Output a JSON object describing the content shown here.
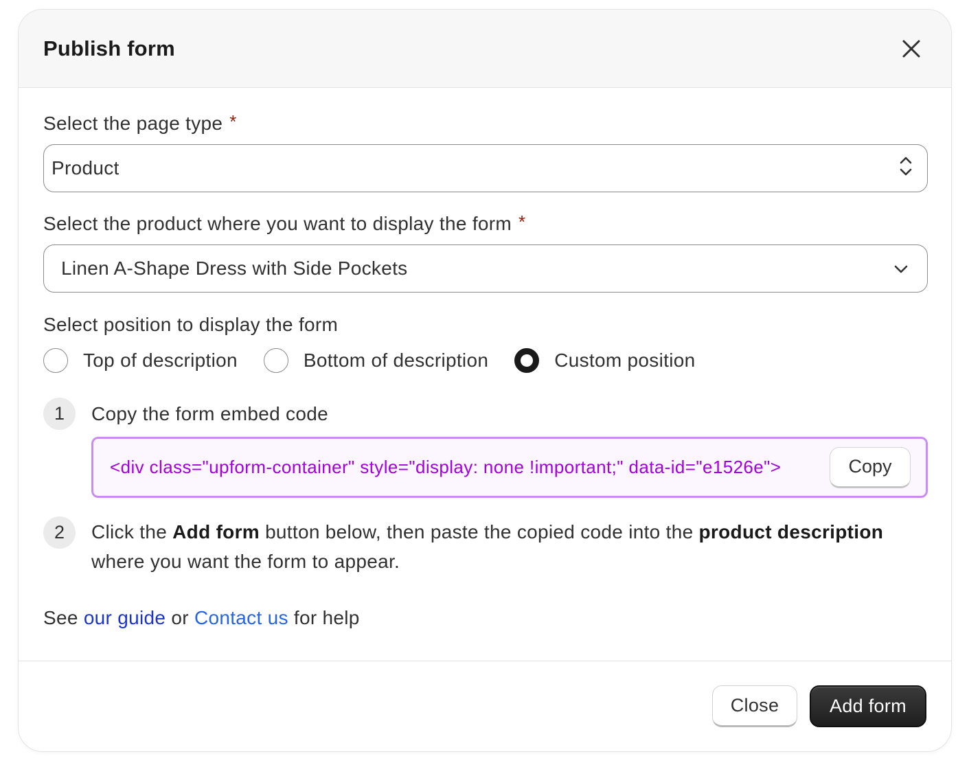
{
  "modal": {
    "title": "Publish form"
  },
  "page_type": {
    "label": "Select the page type",
    "required_mark": "*",
    "value": "Product"
  },
  "product": {
    "label": "Select the product where you want to display the form",
    "required_mark": "*",
    "value": "Linen A-Shape Dress with Side Pockets"
  },
  "position": {
    "label": "Select position to display the form",
    "options": [
      {
        "label": "Top of description",
        "checked": false
      },
      {
        "label": "Bottom of description",
        "checked": false
      },
      {
        "label": "Custom position",
        "checked": true
      }
    ]
  },
  "steps": {
    "step1": {
      "number": "1",
      "title": "Copy the form embed code",
      "code": "<div class=\"upform-container\" style=\"display: none !important;\" data-id=\"e1526e\">",
      "copy_label": "Copy"
    },
    "step2": {
      "number": "2",
      "text_1": "Click the ",
      "bold_1": "Add form",
      "text_2": " button below, then paste the copied code into the ",
      "bold_2": "product description",
      "text_3": " where you want the form to appear."
    }
  },
  "help": {
    "prefix": "See ",
    "guide_link": "our guide",
    "middle": " or ",
    "contact_link": "Contact us",
    "suffix": " for help"
  },
  "footer": {
    "close_label": "Close",
    "add_label": "Add form"
  },
  "colors": {
    "code_text": "#a300e0",
    "code_border": "#c98df2",
    "link_guide": "#1b33d6",
    "link_contact": "#2463eb",
    "required": "#8e1f0b"
  }
}
